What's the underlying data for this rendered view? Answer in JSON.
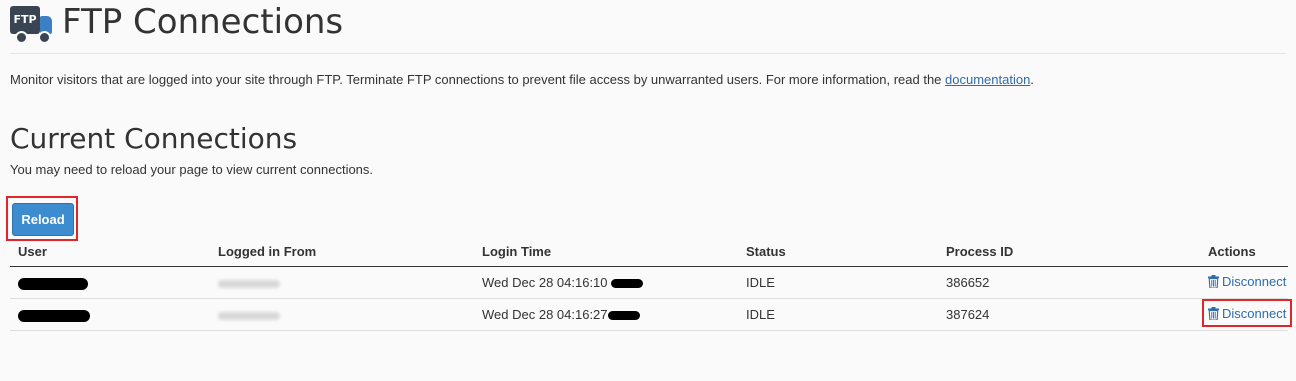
{
  "header": {
    "title": "FTP Connections",
    "icon": "ftp-truck-icon",
    "icon_text": "FTP"
  },
  "intro": {
    "text": "Monitor visitors that are logged into your site through FTP. Terminate FTP connections to prevent file access by unwarranted users. For more information, read the ",
    "link_label": "documentation",
    "suffix": "."
  },
  "section": {
    "title": "Current Connections",
    "description": "You may need to reload your page to view current connections."
  },
  "reload_button": {
    "label": "Reload"
  },
  "table": {
    "headers": {
      "user": "User",
      "from": "Logged in From",
      "time": "Login Time",
      "status": "Status",
      "pid": "Process ID",
      "actions": "Actions"
    },
    "rows": [
      {
        "login_time": "Wed Dec 28 04:16:10",
        "status": "IDLE",
        "process_id": "386652",
        "action_label": "Disconnect"
      },
      {
        "login_time": "Wed Dec 28 04:16:27",
        "status": "IDLE",
        "process_id": "387624",
        "action_label": "Disconnect"
      }
    ]
  },
  "colors": {
    "accent": "#3d8cd0",
    "link": "#2f6da8",
    "highlight": "#e0262b"
  }
}
